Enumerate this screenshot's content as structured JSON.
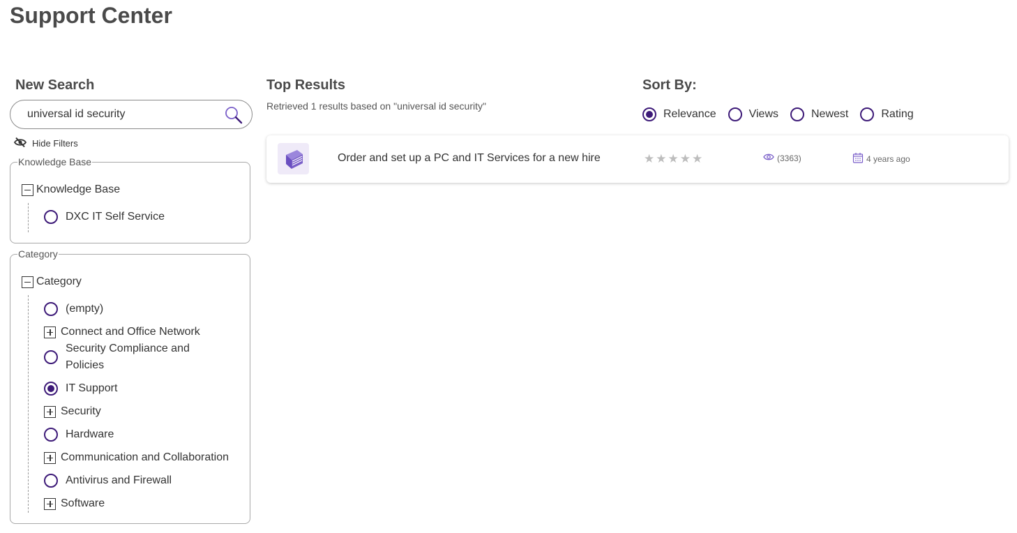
{
  "page": {
    "title": "Support Center"
  },
  "search": {
    "heading": "New Search",
    "value": "universal id security",
    "hide_filters_label": "Hide Filters"
  },
  "knowledge_base_filter": {
    "legend": "Knowledge Base",
    "root_label": "Knowledge Base",
    "items": [
      {
        "label": "DXC IT Self Service",
        "kind": "radio",
        "checked": false
      }
    ]
  },
  "category_filter": {
    "legend": "Category",
    "root_label": "Category",
    "items": [
      {
        "label": "(empty)",
        "kind": "radio",
        "checked": false
      },
      {
        "label": "Connect and Office Network",
        "kind": "expand"
      },
      {
        "label": "Security Compliance and Policies",
        "kind": "radio",
        "checked": false
      },
      {
        "label": "IT Support",
        "kind": "radio",
        "checked": true
      },
      {
        "label": "Security",
        "kind": "expand"
      },
      {
        "label": "Hardware",
        "kind": "radio",
        "checked": false
      },
      {
        "label": "Communication and Collaboration",
        "kind": "expand"
      },
      {
        "label": "Antivirus and Firewall",
        "kind": "radio",
        "checked": false
      },
      {
        "label": "Software",
        "kind": "expand"
      }
    ]
  },
  "results": {
    "heading": "Top Results",
    "summary": "Retrieved 1 results based on \"universal id security\"",
    "items": [
      {
        "title": "Order and set up a PC and IT Services for a new hire",
        "rating": 0,
        "views": "(3363)",
        "age": "4 years ago",
        "icon": "book-icon"
      }
    ]
  },
  "sort": {
    "heading": "Sort By:",
    "options": [
      {
        "label": "Relevance",
        "checked": true
      },
      {
        "label": "Views",
        "checked": false
      },
      {
        "label": "Newest",
        "checked": false
      },
      {
        "label": "Rating",
        "checked": false
      }
    ]
  },
  "colors": {
    "accent": "#3d1a78",
    "icon_purple": "#7a5fc9",
    "book_tile_bg": "#efeaf8",
    "star_empty": "#bdbdbd"
  }
}
